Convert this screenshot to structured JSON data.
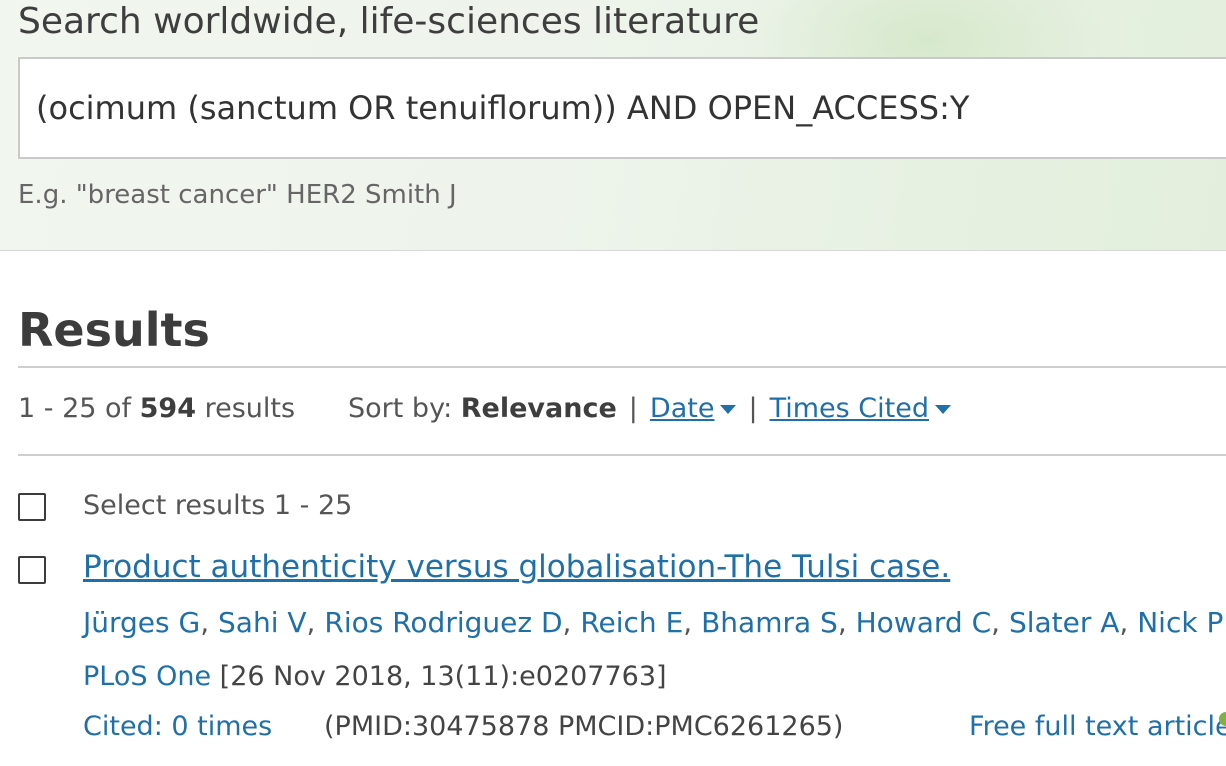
{
  "search": {
    "heading": "Search worldwide, life-sciences literature",
    "query": "(ocimum (sanctum OR tenuiflorum)) AND OPEN_ACCESS:Y",
    "example": "E.g. \"breast cancer\" HER2 Smith J"
  },
  "results": {
    "title": "Results",
    "range": "1 - 25 of ",
    "total": "594",
    "results_word": " results",
    "sort_label": "Sort by: ",
    "sort_current": "Relevance",
    "sort_date": "Date",
    "sort_times_cited": "Times Cited",
    "select_label": "Select results 1 - 25"
  },
  "articles": [
    {
      "title": "Product authenticity versus globalisation-The Tulsi case.",
      "authors": [
        "Jürges G",
        "Sahi V",
        "Rios Rodriguez D",
        "Reich E",
        "Bhamra S",
        "Howard C",
        "Slater A",
        "Nick P"
      ],
      "journal": "PLoS One",
      "citation": " [26 Nov 2018, 13(11):e0207763]",
      "cited": "Cited: 0 times",
      "ids": "(PMID:30475878 PMCID:PMC6261265)",
      "full_text": "Free full text article"
    }
  ],
  "colors": {
    "link": "#1f6fa8",
    "panel": "#eef4ec",
    "open_access": "#7cb342"
  }
}
